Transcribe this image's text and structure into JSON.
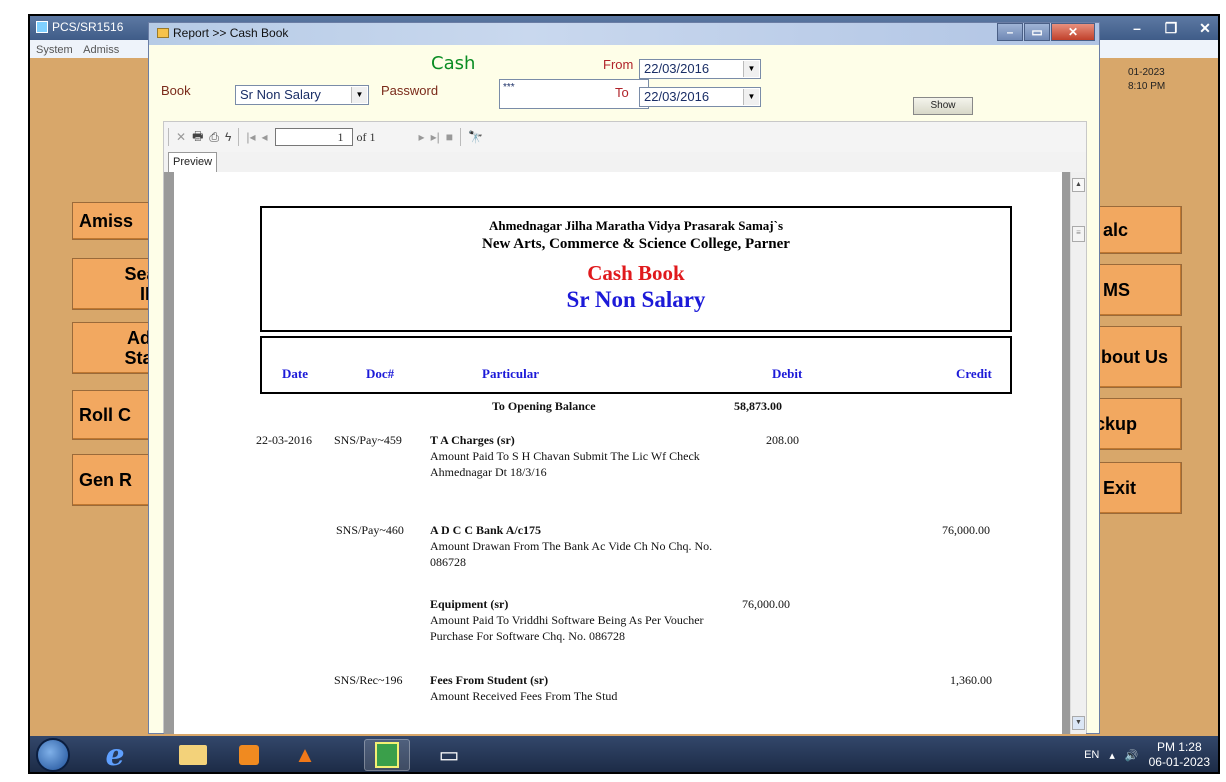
{
  "bg_app": {
    "title": "PCS/SR1516",
    "menu": [
      "System",
      "Admiss"
    ],
    "datetime_line1": "01-2023",
    "datetime_line2": "8:10 PM",
    "left_buttons": [
      "Amiss",
      "Searc ID",
      "Adm Statu",
      "Roll C",
      "Gen R"
    ],
    "right_buttons": [
      "alc",
      "MS",
      "bout Us",
      "ckup",
      "Exit"
    ]
  },
  "report_window": {
    "title": "Report >> Cash Book",
    "cash_label": "Cash",
    "book_label": "Book",
    "book_value": "Sr Non Salary",
    "password_label": "Password",
    "password_value": "***",
    "from_label": "From",
    "from_value": "22/03/2016",
    "to_label": "To",
    "to_value": "22/03/2016",
    "show_label": "Show"
  },
  "viewer": {
    "page_current": "1",
    "page_of": "of 1",
    "tab_label": "Preview"
  },
  "report": {
    "society": "Ahmednagar Jilha Maratha Vidya Prasarak Samaj`s",
    "college": "New Arts, Commerce & Science College, Parner",
    "title": "Cash Book",
    "subtitle": "Sr Non Salary",
    "columns": {
      "date": "Date",
      "doc": "Doc#",
      "particular": "Particular",
      "debit": "Debit",
      "credit": "Credit"
    },
    "opening_label": "To Opening Balance",
    "opening_debit": "58,873.00",
    "entries": [
      {
        "date": "22-03-2016",
        "doc": "SNS/Pay~459",
        "head": "T A Charges (sr)",
        "desc": "Amount Paid To S H Chavan Submit The Lic Wf Check Ahmednagar Dt 18/3/16",
        "debit": "208.00",
        "credit": ""
      },
      {
        "date": "",
        "doc": "SNS/Pay~460",
        "head": "A D C C Bank A/c175",
        "desc": "Amount Drawan From The Bank Ac Vide Ch No Chq. No. 086728",
        "debit": "",
        "credit": "76,000.00"
      },
      {
        "date": "",
        "doc": "",
        "head": "Equipment (sr)",
        "desc": "Amount Paid To Vriddhi Software Being As Per Voucher Purchase For Software Chq. No. 086728",
        "debit": "76,000.00",
        "credit": ""
      },
      {
        "date": "",
        "doc": "SNS/Rec~196",
        "head": "Fees From Student (sr)",
        "desc": "Amount Received Fees From The Stud",
        "debit": "",
        "credit": "1,360.00"
      }
    ]
  },
  "taskbar": {
    "lang": "EN",
    "time": "PM 1:28",
    "date": "06-01-2023"
  }
}
